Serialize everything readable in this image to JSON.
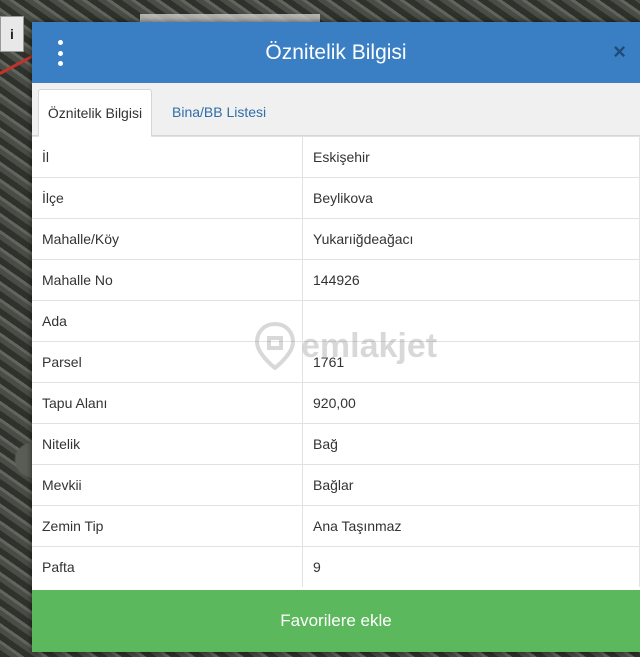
{
  "map": {
    "chip_label": "i"
  },
  "dialog": {
    "title": "Öznitelik Bilgisi",
    "close_label": "×"
  },
  "tabs": [
    {
      "label": "Öznitelik Bilgisi",
      "active": true
    },
    {
      "label": "Bina/BB Listesi",
      "active": false
    }
  ],
  "attributes": [
    {
      "key": "İl",
      "value": "Eskişehir"
    },
    {
      "key": "İlçe",
      "value": "Beylikova"
    },
    {
      "key": "Mahalle/Köy",
      "value": "Yukarıiğdeağacı"
    },
    {
      "key": "Mahalle No",
      "value": "144926"
    },
    {
      "key": "Ada",
      "value": ""
    },
    {
      "key": "Parsel",
      "value": "1761"
    },
    {
      "key": "Tapu Alanı",
      "value": "920,00"
    },
    {
      "key": "Nitelik",
      "value": "Bağ"
    },
    {
      "key": "Mevkii",
      "value": "Bağlar"
    },
    {
      "key": "Zemin Tip",
      "value": "Ana Taşınmaz"
    },
    {
      "key": "Pafta",
      "value": "9"
    }
  ],
  "watermark": {
    "text": "emlakjet"
  },
  "footer": {
    "favorite_label": "Favorilere ekle"
  },
  "colors": {
    "header": "#3a7fc3",
    "tab_link": "#2f6ea8",
    "favorite_button": "#5cb85c"
  }
}
